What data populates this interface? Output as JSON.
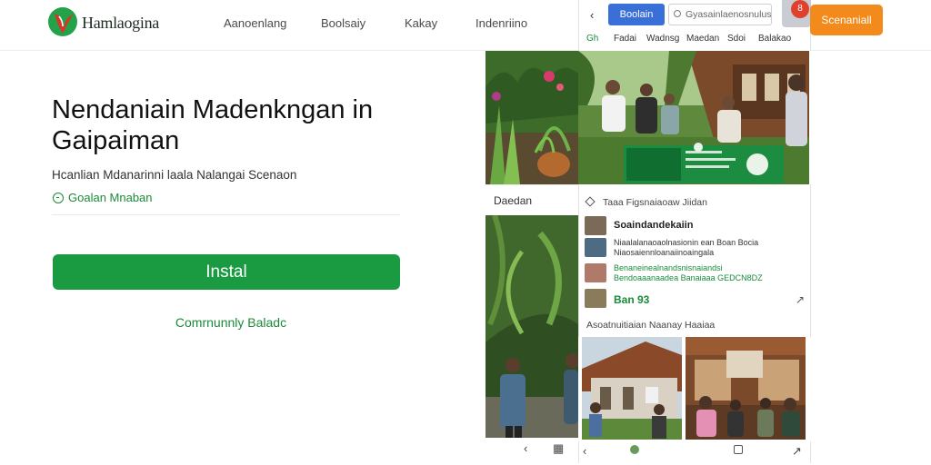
{
  "header": {
    "brand": "Hamlaogina",
    "nav": [
      "Aanoenlang",
      "Boolsaiy",
      "Kakay",
      "Indenriino"
    ]
  },
  "hero": {
    "title": "Nendaniain Madenkngan in Gaipaiman",
    "subtitle": "Hcanlian Mdanarinni laala Nalangai Scenaon",
    "link": "Goalan Mnaban",
    "install_label": "Instal",
    "community_label": "Comrnunnly Baladc"
  },
  "preview_toolbar": {
    "back_icon": "chevron-left-icon",
    "button_label": "Boolain",
    "search_placeholder": "Gyasainlaenosnulus",
    "tabs": [
      "Gh",
      "Fadai",
      "Wadnsg",
      "Maedan",
      "Sdoi",
      "Balakao"
    ],
    "notification_count": "8",
    "cta_label": "Scenaniall",
    "accent_color": "#3a6fd8",
    "cta_color": "#f28a1c"
  },
  "preview_left": {
    "label": "Daedan"
  },
  "preview_feed": {
    "header": "Taaa Figsnaiaoaw Jiidan",
    "rows": [
      {
        "title": "Soaindandekaiin",
        "lines": []
      },
      {
        "title": "",
        "lines": [
          "Niaalalanaoaolnasionin ean Boan Bocia",
          "Niaosaiennloanaiinoaingala"
        ]
      },
      {
        "title": "",
        "lines": [
          "Benaneinealnandsnisnaiandsi",
          "Bendoaaanaadea Banaiaaa GEDCN8DZ"
        ]
      },
      {
        "title": "",
        "price": "Ban 93",
        "lines": []
      }
    ],
    "footer": "Asoatnuitiaian Naanay Haaiaa"
  },
  "bottom_nav": [
    "chevron-left-icon",
    "circle-icon",
    "square-icon",
    "share-icon"
  ],
  "colors": {
    "primary_green": "#1a9a41",
    "link_green": "#1c8a3a"
  }
}
